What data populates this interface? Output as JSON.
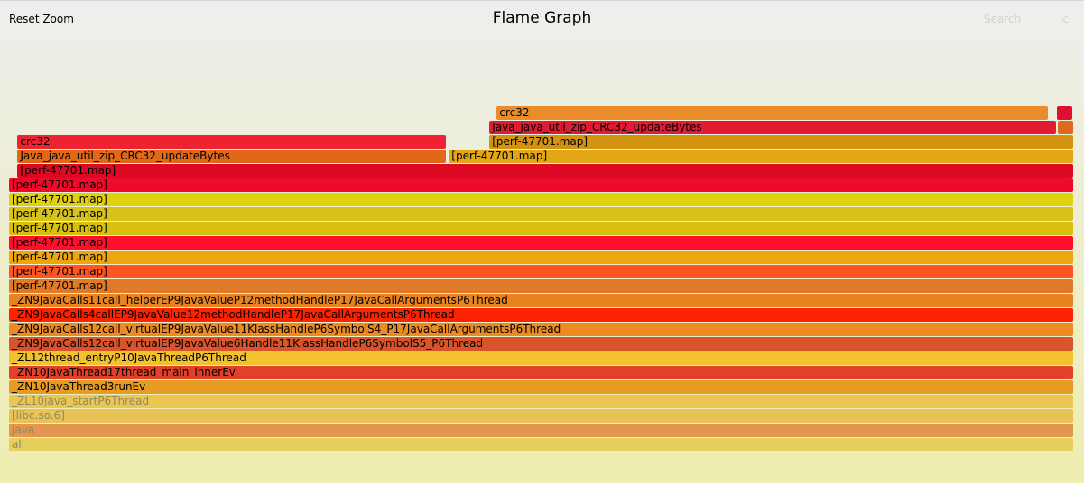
{
  "header": {
    "reset_zoom_label": "Reset Zoom",
    "title": "Flame Graph",
    "search_label": "Search",
    "ic_label": "ic"
  },
  "frames": [
    {
      "label": "all",
      "depth": 0,
      "start": 0.0,
      "end": 1.0,
      "color": "#e6cf5a",
      "faded": true
    },
    {
      "label": "java",
      "depth": 1,
      "start": 0.0,
      "end": 1.0,
      "color": "#e2964e",
      "faded": true
    },
    {
      "label": "[libc.so.6]",
      "depth": 2,
      "start": 0.0,
      "end": 1.0,
      "color": "#e9c256",
      "faded": true
    },
    {
      "label": "_ZL10java_startP6Thread",
      "depth": 3,
      "start": 0.0,
      "end": 1.0,
      "color": "#ecc650",
      "faded": true
    },
    {
      "label": "_ZN10JavaThread3runEv",
      "depth": 4,
      "start": 0.0,
      "end": 1.0,
      "color": "#e89b22",
      "faded": false
    },
    {
      "label": "_ZN10JavaThread17thread_main_innerEv",
      "depth": 5,
      "start": 0.0,
      "end": 1.0,
      "color": "#e3402a",
      "faded": false
    },
    {
      "label": "_ZL12thread_entryP10JavaThreadP6Thread",
      "depth": 6,
      "start": 0.0,
      "end": 1.0,
      "color": "#f2c22e",
      "faded": false
    },
    {
      "label": "_ZN9JavaCalls12call_virtualEP9JavaValue6Handle11KlassHandleP6SymbolS5_P6Thread",
      "depth": 7,
      "start": 0.0,
      "end": 1.0,
      "color": "#d9542a",
      "faded": false
    },
    {
      "label": "_ZN9JavaCalls12call_virtualEP9JavaValue11KlassHandleP6SymbolS4_P17JavaCallArgumentsP6Thread",
      "depth": 8,
      "start": 0.0,
      "end": 1.0,
      "color": "#ee8a22",
      "faded": false
    },
    {
      "label": "_ZN9JavaCalls4callEP9JavaValue12methodHandleP17JavaCallArgumentsP6Thread",
      "depth": 9,
      "start": 0.0,
      "end": 1.0,
      "color": "#ff2200",
      "faded": false
    },
    {
      "label": "_ZN9JavaCalls11call_helperEP9JavaValueP12methodHandleP17JavaCallArgumentsP6Thread",
      "depth": 10,
      "start": 0.0,
      "end": 1.0,
      "color": "#e88320",
      "faded": false
    },
    {
      "label": "[perf-47701.map]",
      "depth": 11,
      "start": 0.0,
      "end": 1.0,
      "color": "#e07a28",
      "faded": false
    },
    {
      "label": "[perf-47701.map]",
      "depth": 12,
      "start": 0.0,
      "end": 1.0,
      "color": "#ff5522",
      "faded": false
    },
    {
      "label": "[perf-47701.map]",
      "depth": 13,
      "start": 0.0,
      "end": 1.0,
      "color": "#eea60e",
      "faded": false
    },
    {
      "label": "[perf-47701.map]",
      "depth": 14,
      "start": 0.0,
      "end": 1.0,
      "color": "#ff0f2a",
      "faded": false
    },
    {
      "label": "[perf-47701.map]",
      "depth": 15,
      "start": 0.0,
      "end": 1.0,
      "color": "#d8c010",
      "faded": false
    },
    {
      "label": "[perf-47701.map]",
      "depth": 16,
      "start": 0.0,
      "end": 1.0,
      "color": "#d6c21a",
      "faded": false
    },
    {
      "label": "[perf-47701.map]",
      "depth": 17,
      "start": 0.0,
      "end": 1.0,
      "color": "#e0d010",
      "faded": false
    },
    {
      "label": "[perf-47701.map]",
      "depth": 18,
      "start": 0.0,
      "end": 1.0,
      "color": "#f00a2a",
      "faded": false
    },
    {
      "label": "[perf-47701.map]",
      "depth": 19,
      "start": 0.008,
      "end": 1.0,
      "color": "#dd0822",
      "faded": false
    },
    {
      "label": "Java_java_util_zip_CRC32_updateBytes",
      "depth": 20,
      "start": 0.008,
      "end": 0.411,
      "color": "#e26818",
      "faded": false
    },
    {
      "label": "[perf-47701.map]",
      "depth": 20,
      "start": 0.413,
      "end": 1.0,
      "color": "#e2a616",
      "faded": false
    },
    {
      "label": "crc32",
      "depth": 21,
      "start": 0.008,
      "end": 0.411,
      "color": "#ee2230",
      "faded": false
    },
    {
      "label": "[perf-47701.map]",
      "depth": 21,
      "start": 0.451,
      "end": 1.0,
      "color": "#d29410",
      "faded": false
    },
    {
      "label": "Java_java_util_zip_CRC32_updateBytes",
      "depth": 22,
      "start": 0.451,
      "end": 0.984,
      "color": "#e01b32",
      "faded": false
    },
    {
      "label": "",
      "depth": 22,
      "start": 0.985,
      "end": 1.0,
      "color": "#e0681e",
      "faded": false
    },
    {
      "label": "crc32",
      "depth": 23,
      "start": 0.458,
      "end": 0.976,
      "color": "#ea8c2a",
      "faded": false
    },
    {
      "label": "",
      "depth": 23,
      "start": 0.984,
      "end": 0.999,
      "color": "#dd1030",
      "faded": false
    }
  ]
}
